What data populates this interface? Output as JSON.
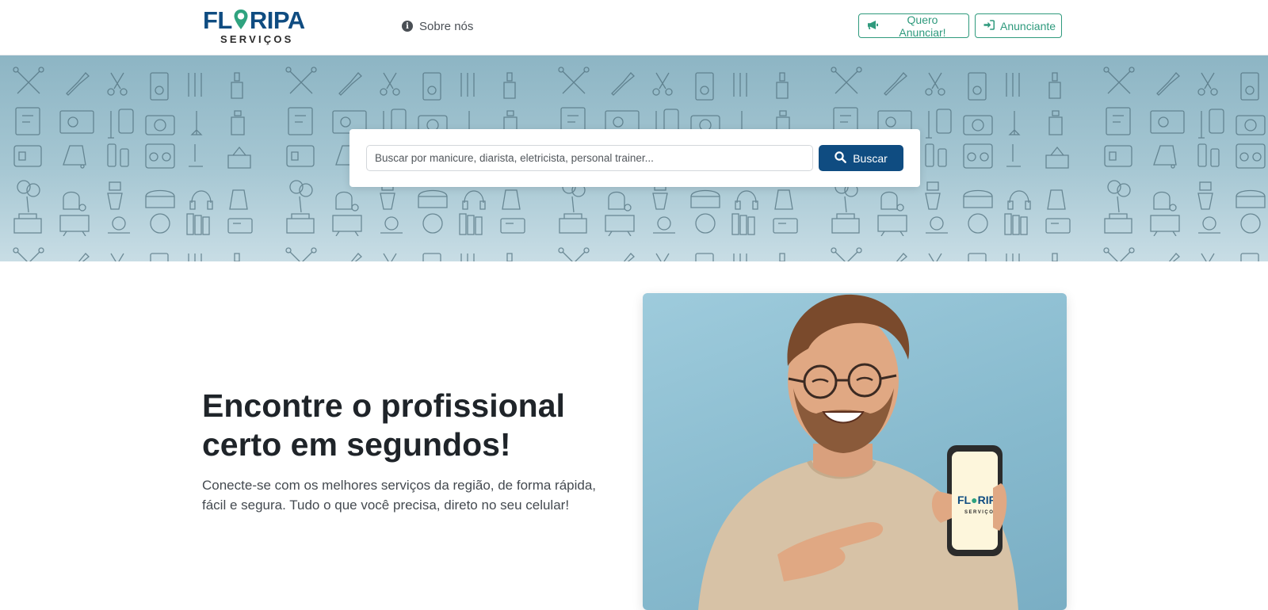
{
  "header": {
    "logo": {
      "main_before": "FL",
      "main_after": "RIPA",
      "sub": "SERVIÇOS"
    },
    "about_label": "Sobre nós",
    "buttons": {
      "advertise": "Quero Anunciar!",
      "advertiser": "Anunciante"
    },
    "icons": {
      "about": "info-icon",
      "advertise": "bullhorn-icon",
      "advertiser": "sign-in-icon"
    }
  },
  "search": {
    "placeholder": "Buscar por manicure, diarista, eletricista, personal trainer...",
    "value": "",
    "button_label": "Buscar",
    "button_icon": "search-icon"
  },
  "hero": {
    "title": "Encontre o profissional certo em segundos!",
    "text": "Conecte-se com os melhores serviços da região, de forma rápida, fácil e segura. Tudo o que você precisa, direto no seu celular!",
    "phone_logo": {
      "main_before": "FL",
      "main_after": "RIPA",
      "sub": "SERVIÇOS"
    }
  },
  "colors": {
    "brand_blue": "#0f4c81",
    "brand_green": "#2f9a7d",
    "banner_top": "#8db5c4",
    "banner_bottom": "#c8dde5"
  }
}
